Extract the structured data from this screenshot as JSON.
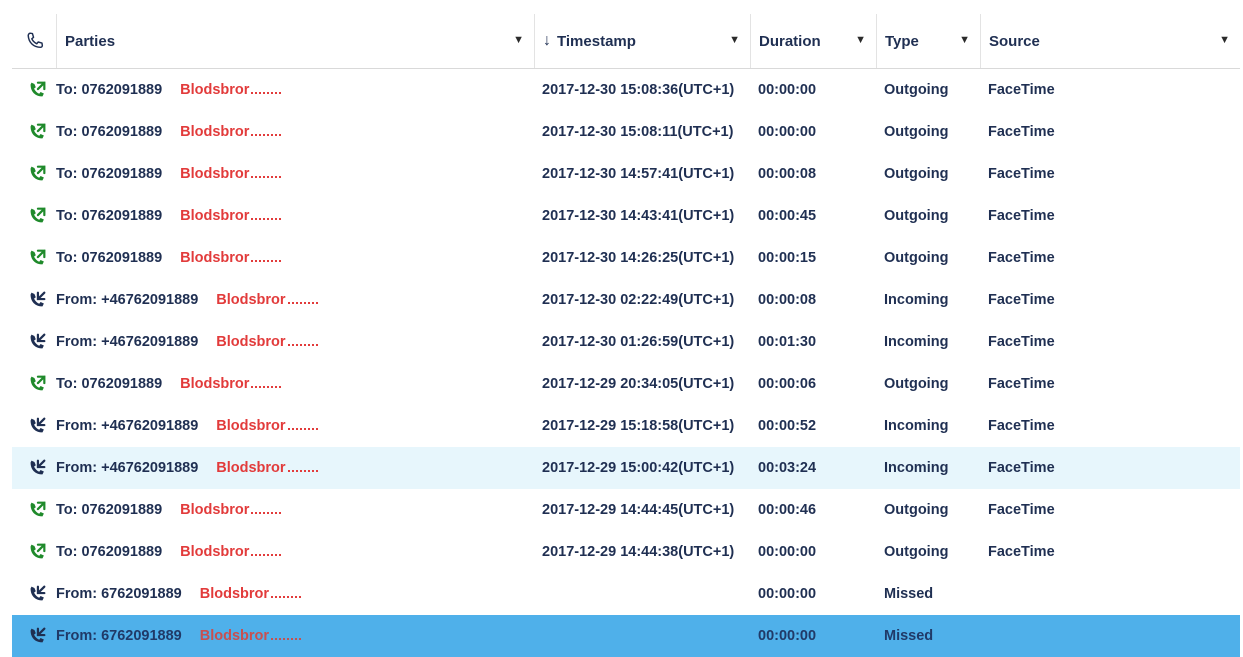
{
  "header": {
    "phone_icon": "phone-icon",
    "parties": "Parties",
    "timestamp": "Timestamp",
    "sort_arrow": "↓",
    "duration": "Duration",
    "type": "Type",
    "source": "Source"
  },
  "colors": {
    "outgoing_icon": "#1f8a2b",
    "incoming_icon": "#1f2f52",
    "name": "#e23b3b",
    "row_hover": "#e7f6fc",
    "row_selected": "#4fb0ea"
  },
  "rows": [
    {
      "dir": "out",
      "party": "To: 0762091889",
      "name": "Blodsbror",
      "ts": "2017-12-30 15:08:36(UTC+1)",
      "dur": "00:00:00",
      "type": "Outgoing",
      "source": "FaceTime"
    },
    {
      "dir": "out",
      "party": "To: 0762091889",
      "name": "Blodsbror",
      "ts": "2017-12-30 15:08:11(UTC+1)",
      "dur": "00:00:00",
      "type": "Outgoing",
      "source": "FaceTime"
    },
    {
      "dir": "out",
      "party": "To: 0762091889",
      "name": "Blodsbror",
      "ts": "2017-12-30 14:57:41(UTC+1)",
      "dur": "00:00:08",
      "type": "Outgoing",
      "source": "FaceTime"
    },
    {
      "dir": "out",
      "party": "To: 0762091889",
      "name": "Blodsbror",
      "ts": "2017-12-30 14:43:41(UTC+1)",
      "dur": "00:00:45",
      "type": "Outgoing",
      "source": "FaceTime"
    },
    {
      "dir": "out",
      "party": "To: 0762091889",
      "name": "Blodsbror",
      "ts": "2017-12-30 14:26:25(UTC+1)",
      "dur": "00:00:15",
      "type": "Outgoing",
      "source": "FaceTime"
    },
    {
      "dir": "in",
      "party": "From: +46762091889",
      "name": "Blodsbror",
      "ts": "2017-12-30 02:22:49(UTC+1)",
      "dur": "00:00:08",
      "type": "Incoming",
      "source": "FaceTime"
    },
    {
      "dir": "in",
      "party": "From: +46762091889",
      "name": "Blodsbror",
      "ts": "2017-12-30 01:26:59(UTC+1)",
      "dur": "00:01:30",
      "type": "Incoming",
      "source": "FaceTime"
    },
    {
      "dir": "out",
      "party": "To: 0762091889",
      "name": "Blodsbror",
      "ts": "2017-12-29 20:34:05(UTC+1)",
      "dur": "00:00:06",
      "type": "Outgoing",
      "source": "FaceTime"
    },
    {
      "dir": "in",
      "party": "From: +46762091889",
      "name": "Blodsbror",
      "ts": "2017-12-29 15:18:58(UTC+1)",
      "dur": "00:00:52",
      "type": "Incoming",
      "source": "FaceTime"
    },
    {
      "dir": "in",
      "party": "From: +46762091889",
      "name": "Blodsbror",
      "ts": "2017-12-29 15:00:42(UTC+1)",
      "dur": "00:03:24",
      "type": "Incoming",
      "source": "FaceTime",
      "state": "hover"
    },
    {
      "dir": "out",
      "party": "To: 0762091889",
      "name": "Blodsbror",
      "ts": "2017-12-29 14:44:45(UTC+1)",
      "dur": "00:00:46",
      "type": "Outgoing",
      "source": "FaceTime"
    },
    {
      "dir": "out",
      "party": "To: 0762091889",
      "name": "Blodsbror",
      "ts": "2017-12-29 14:44:38(UTC+1)",
      "dur": "00:00:00",
      "type": "Outgoing",
      "source": "FaceTime"
    },
    {
      "dir": "in",
      "party": "From: 6762091889",
      "name": "Blodsbror",
      "ts": "",
      "dur": "00:00:00",
      "type": "Missed",
      "source": ""
    },
    {
      "dir": "in",
      "party": "From: 6762091889",
      "name": "Blodsbror",
      "ts": "",
      "dur": "00:00:00",
      "type": "Missed",
      "source": "",
      "state": "selected"
    }
  ]
}
